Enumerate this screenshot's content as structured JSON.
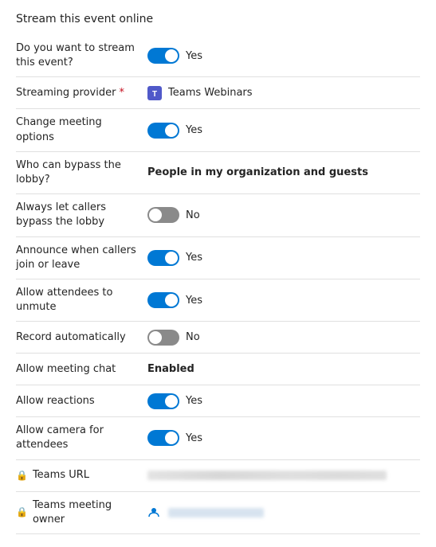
{
  "title": "Stream this event online",
  "rows": [
    {
      "id": "stream-event",
      "label": "Do you want to stream this event?",
      "type": "toggle",
      "toggleOn": true,
      "valueText": "Yes",
      "required": false,
      "hasLock": false
    },
    {
      "id": "streaming-provider",
      "label": "Streaming provider",
      "type": "icon-text",
      "valueText": "Teams Webinars",
      "required": true,
      "hasLock": false
    },
    {
      "id": "change-meeting",
      "label": "Change meeting options",
      "type": "toggle",
      "toggleOn": true,
      "valueText": "Yes",
      "required": false,
      "hasLock": false
    },
    {
      "id": "bypass-lobby",
      "label": "Who can bypass the lobby?",
      "type": "bold-text",
      "valueText": "People in my organization and guests",
      "required": false,
      "hasLock": false
    },
    {
      "id": "callers-bypass",
      "label": "Always let callers bypass the lobby",
      "type": "toggle",
      "toggleOn": false,
      "valueText": "No",
      "required": false,
      "hasLock": false
    },
    {
      "id": "announce-callers",
      "label": "Announce when callers join or leave",
      "type": "toggle",
      "toggleOn": true,
      "valueText": "Yes",
      "required": false,
      "hasLock": false
    },
    {
      "id": "allow-unmute",
      "label": "Allow attendees to unmute",
      "type": "toggle",
      "toggleOn": true,
      "valueText": "Yes",
      "required": false,
      "hasLock": false
    },
    {
      "id": "record-auto",
      "label": "Record automatically",
      "type": "toggle",
      "toggleOn": false,
      "valueText": "No",
      "required": false,
      "hasLock": false
    },
    {
      "id": "meeting-chat",
      "label": "Allow meeting chat",
      "type": "bold-text",
      "valueText": "Enabled",
      "required": false,
      "hasLock": false
    },
    {
      "id": "allow-reactions",
      "label": "Allow reactions",
      "type": "toggle",
      "toggleOn": true,
      "valueText": "Yes",
      "required": false,
      "hasLock": false
    },
    {
      "id": "allow-camera",
      "label": "Allow camera for attendees",
      "type": "toggle",
      "toggleOn": true,
      "valueText": "Yes",
      "required": false,
      "hasLock": false
    },
    {
      "id": "teams-url",
      "label": "Teams URL",
      "type": "blurred-url",
      "required": false,
      "hasLock": true
    },
    {
      "id": "teams-owner",
      "label": "Teams meeting owner",
      "type": "blurred-person",
      "required": false,
      "hasLock": true
    }
  ],
  "icons": {
    "lock": "🔒",
    "teams": "T",
    "person": "👤"
  }
}
